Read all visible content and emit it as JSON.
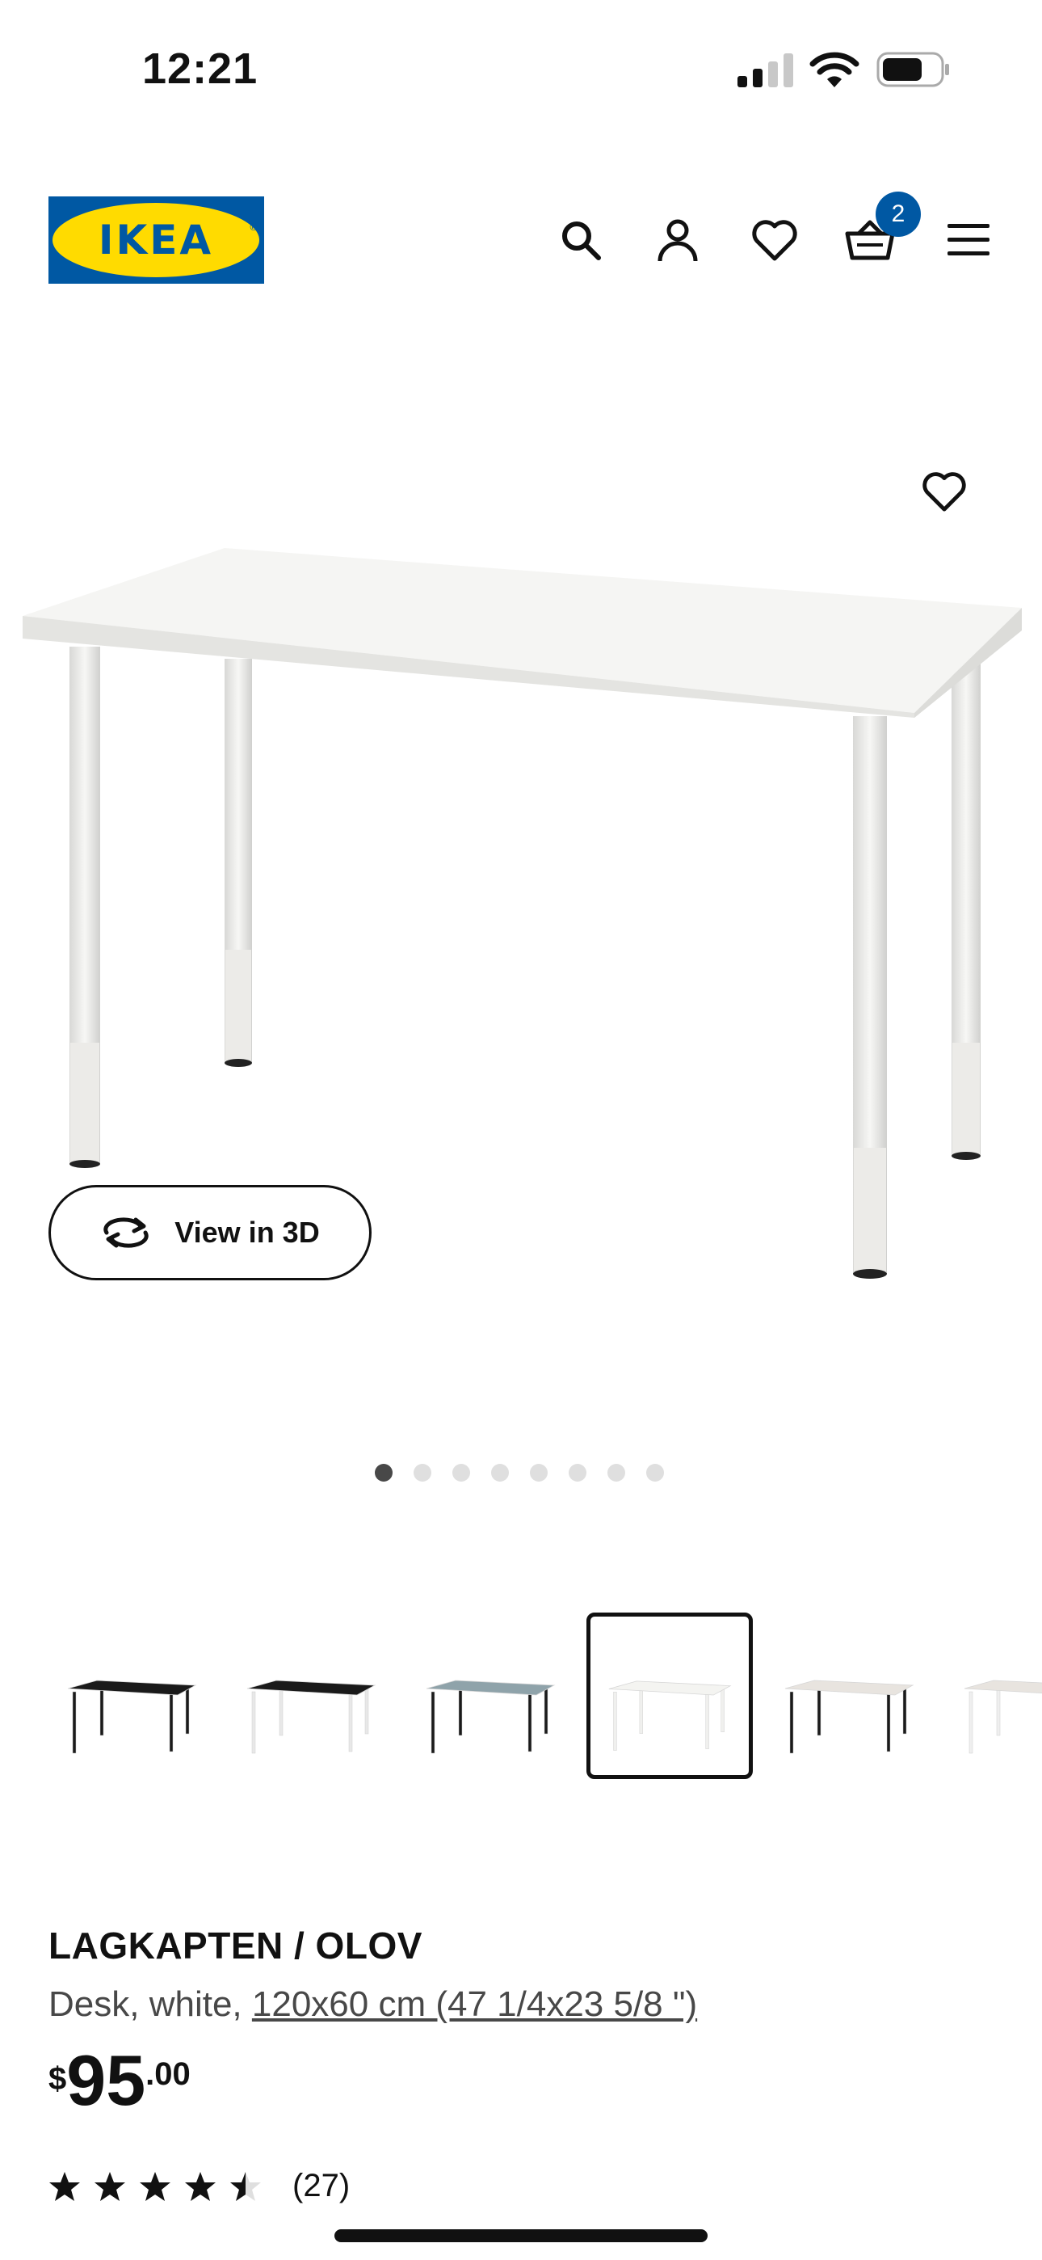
{
  "status_bar": {
    "time": "12:21"
  },
  "header": {
    "logo_text": "IKEA",
    "cart_count": "2",
    "brand_colors": {
      "blue": "#0058a3",
      "yellow": "#ffdb00"
    },
    "icons": [
      "search-icon",
      "account-icon",
      "heart-icon",
      "basket-icon",
      "hamburger-menu-icon"
    ]
  },
  "gallery": {
    "view_3d_label": "View in 3D",
    "slide_count": 8,
    "active_slide": 1,
    "thumbnails": [
      {
        "top": "#1a1a1a",
        "legs": "#1a1a1a",
        "selected": false
      },
      {
        "top": "#1a1a1a",
        "legs": "#e8e8e8",
        "selected": false
      },
      {
        "top": "#8fa3aa",
        "legs": "#1a1a1a",
        "selected": false
      },
      {
        "top": "#f4f4f1",
        "legs": "#f0f0ee",
        "selected": true
      },
      {
        "top": "#e8e4df",
        "legs": "#1a1a1a",
        "selected": false
      },
      {
        "top": "#e8e4df",
        "legs": "#efefef",
        "selected": false
      }
    ]
  },
  "product": {
    "name": "LAGKAPTEN / OLOV",
    "description_prefix": "Desk, white, ",
    "size_link": "120x60 cm (47 1/4x23 5/8 \")",
    "price": {
      "currency": "$",
      "integer": "95",
      "decimal": ".00"
    },
    "rating": {
      "value": 4.5,
      "max": 5
    },
    "review_count": "(27)"
  }
}
